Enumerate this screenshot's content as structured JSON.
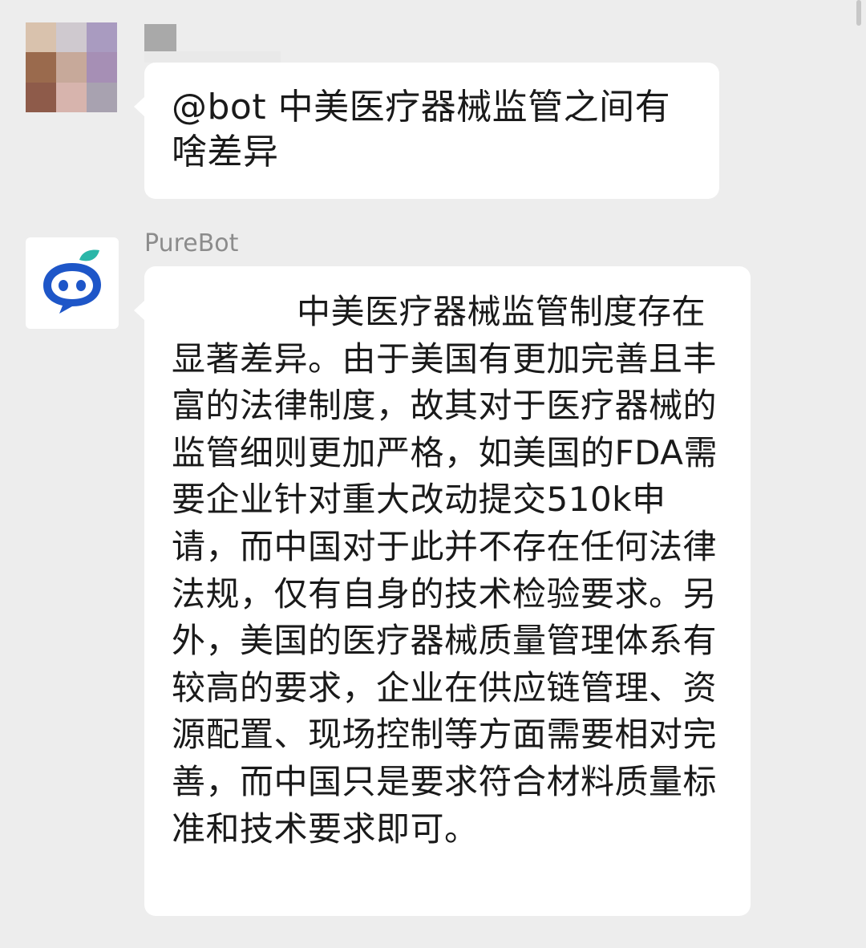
{
  "colors": {
    "background": "#ededed",
    "bubble": "#ffffff",
    "text": "#1a1a1a",
    "nickname": "#8c8c8c",
    "bot_avatar_blue": "#1e56c8",
    "bot_avatar_leaf": "#2bb6a8"
  },
  "messages": [
    {
      "sender": "",
      "avatar": "blurred-user-avatar",
      "text": "@bot 中美医疗器械监管之间有啥差异"
    },
    {
      "sender": "PureBot",
      "avatar": "purebot-logo-icon",
      "text": "中美医疗器械监管制度存在显著差异。由于美国有更加完善且丰富的法律制度，故其对于医疗器械的监管细则更加严格，如美国的FDA需要企业针对重大改动提交510k申请，而中国对于此并不存在任何法律法规，仅有自身的技术检验要求。另外，美国的医疗器械质量管理体系有较高的要求，企业在供应链管理、资源配置、现场控制等方面需要相对完善，而中国只是要求符合材料质量标准和技术要求即可。"
    }
  ]
}
